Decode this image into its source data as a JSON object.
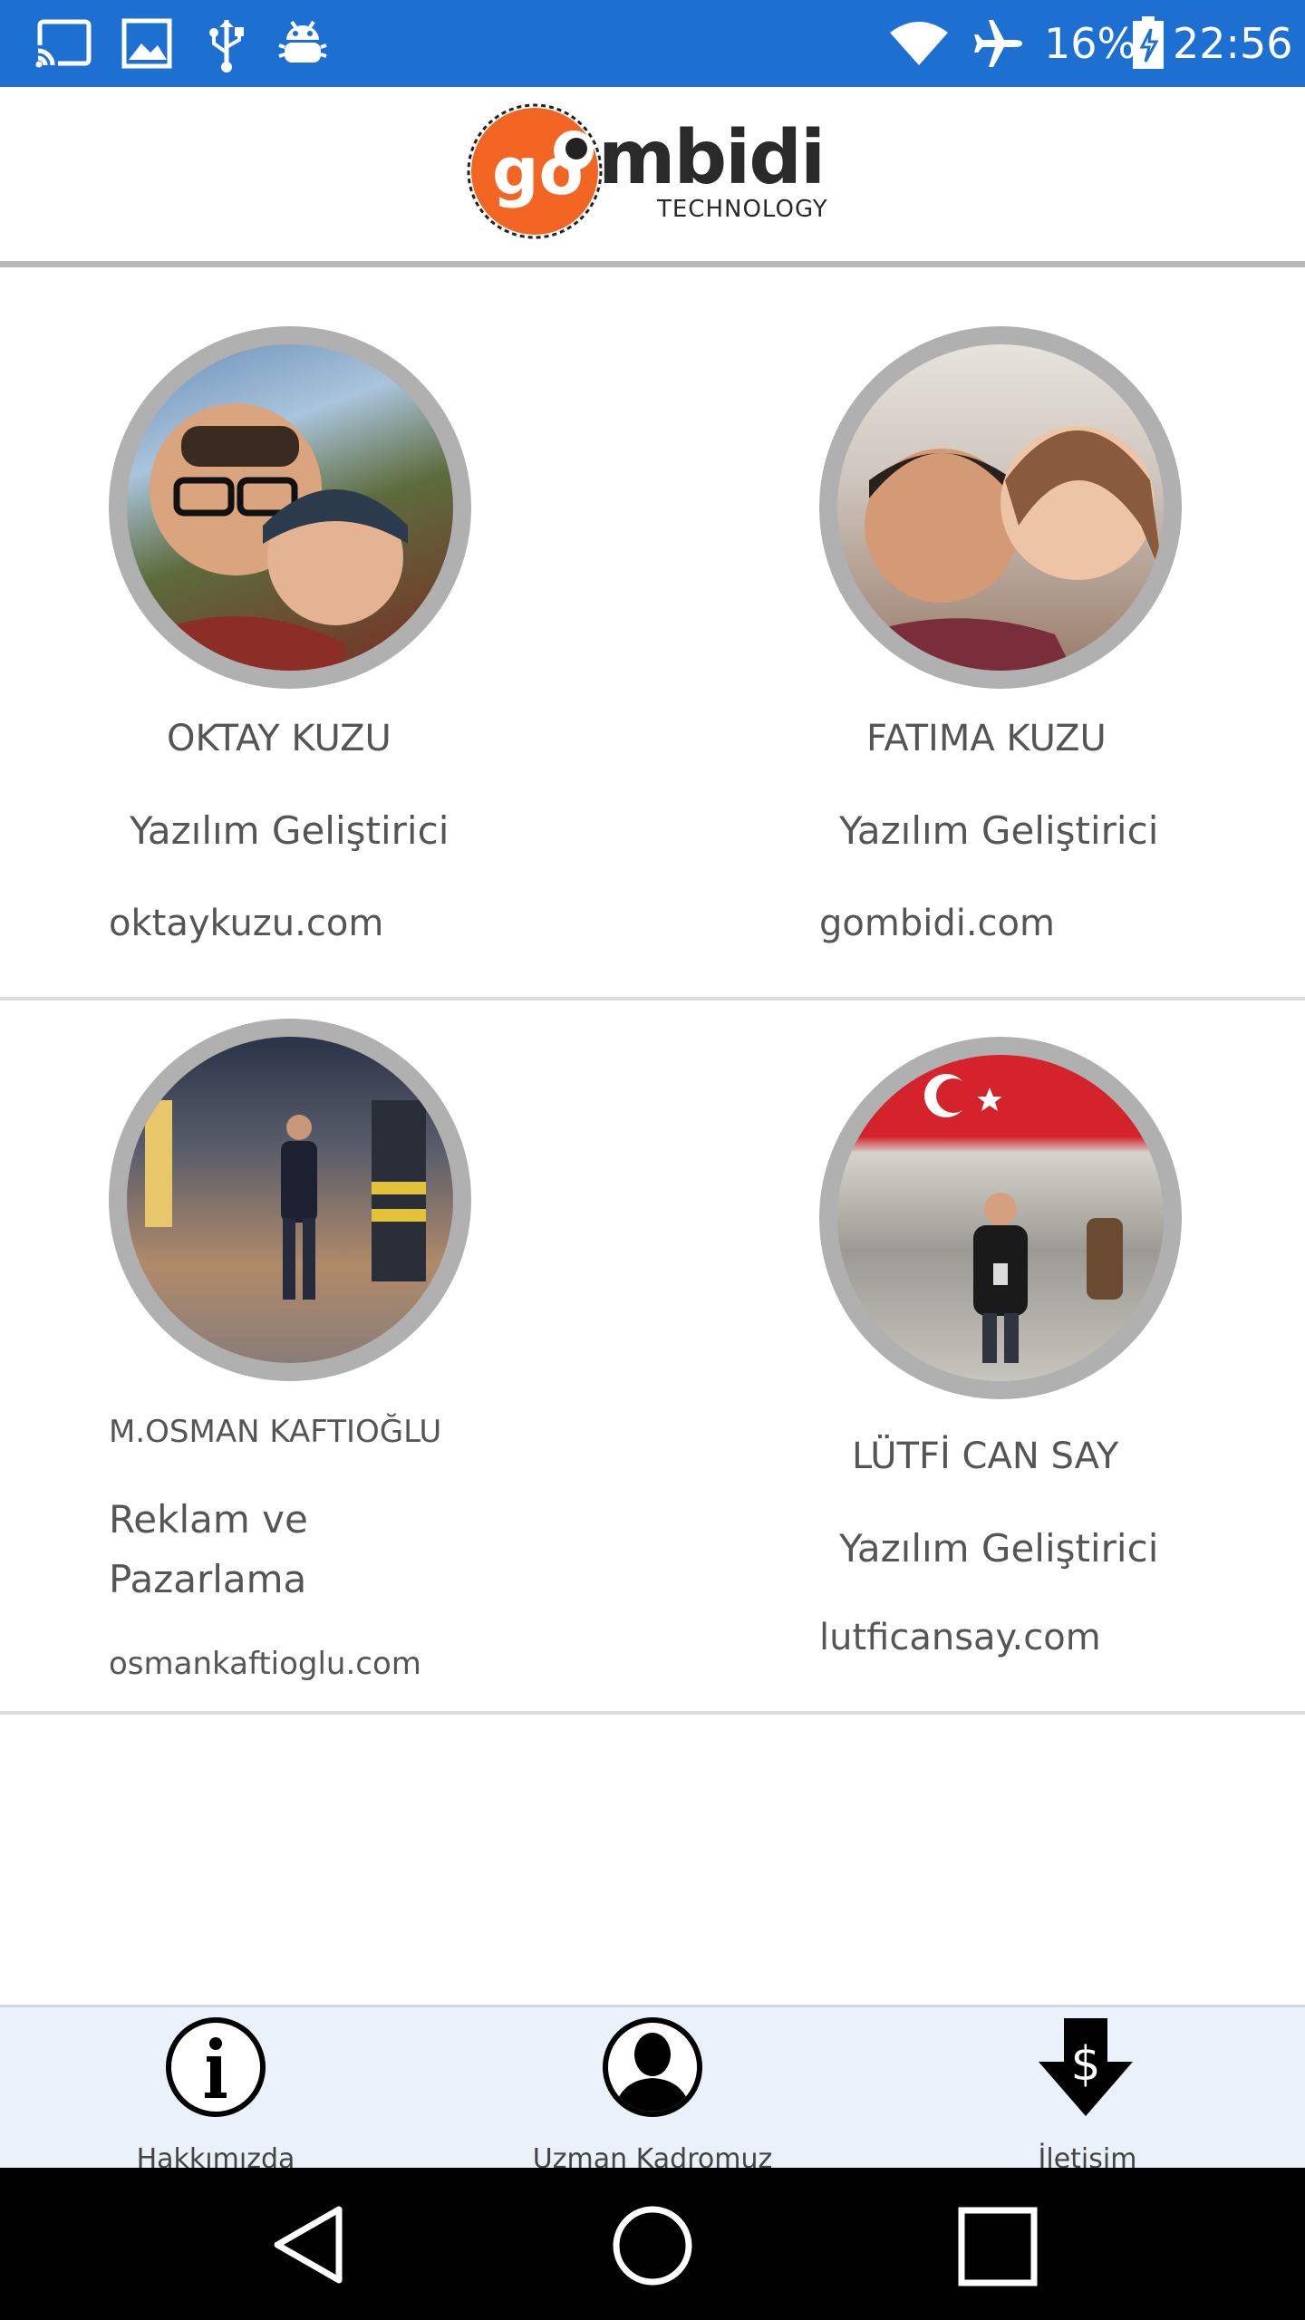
{
  "status_bar": {
    "battery": "16%",
    "time": "22:56",
    "icons": [
      "cast-icon",
      "image-icon",
      "usb-icon",
      "android-debug-icon",
      "wifi-icon",
      "airplane-icon",
      "battery-icon"
    ]
  },
  "header": {
    "logo_word": "mbidi",
    "logo_sub": "TECHNOLOGY",
    "logo_go": "go"
  },
  "team": [
    {
      "name": "OKTAY KUZU",
      "role": "Yazılım Geliştirici",
      "site": "oktaykuzu.com"
    },
    {
      "name": "FATIMA KUZU",
      "role": "Yazılım Geliştirici",
      "site": "gombidi.com"
    },
    {
      "name": "M.OSMAN KAFTIOĞLU",
      "role_line1": "Reklam ve",
      "role_line2": "Pazarlama",
      "site": "osmankaftioglu.com"
    },
    {
      "name": "LÜTFİ CAN SAY",
      "role": "Yazılım Geliştirici",
      "site": "lutficansay.com"
    }
  ],
  "bottom_nav": [
    {
      "label": "Hakkımızda",
      "icon": "info-icon"
    },
    {
      "label": "Uzman Kadromuz",
      "icon": "person-icon"
    },
    {
      "label": "İletişim",
      "icon": "dollar-download-icon"
    }
  ],
  "colors": {
    "status_bar": "#1d6fd1",
    "logo_orange": "#f26522",
    "text": "#555555",
    "nav_bg": "#eaf1fa"
  }
}
